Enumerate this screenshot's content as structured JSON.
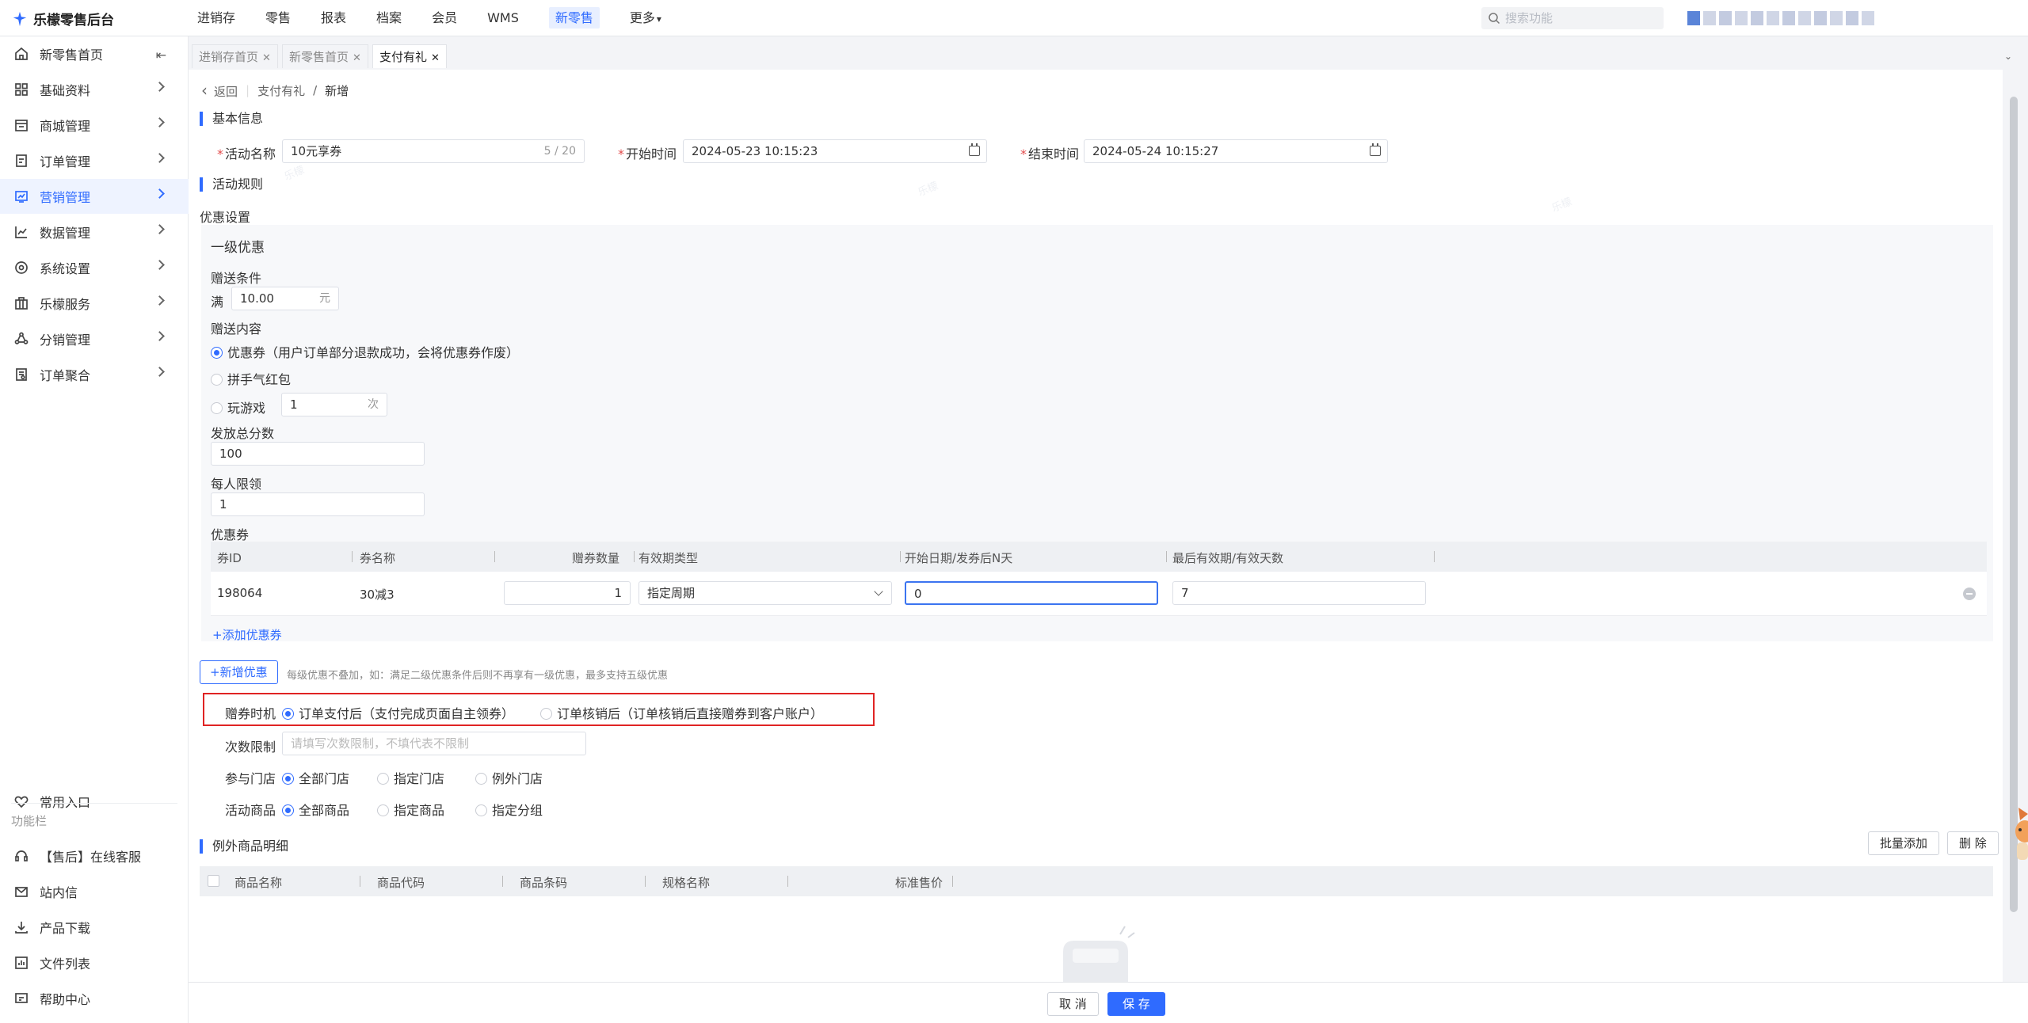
{
  "app": {
    "title": "乐檬零售后台"
  },
  "topnav": [
    {
      "label": "进销存",
      "active": false
    },
    {
      "label": "零售",
      "active": false
    },
    {
      "label": "报表",
      "active": false
    },
    {
      "label": "档案",
      "active": false
    },
    {
      "label": "会员",
      "active": false
    },
    {
      "label": "WMS",
      "active": false
    },
    {
      "label": "新零售",
      "active": true
    },
    {
      "label": "更多",
      "active": false
    }
  ],
  "search": {
    "placeholder": "搜索功能"
  },
  "sidebar": {
    "items": [
      {
        "label": "新零售首页",
        "icon": "home-icon"
      },
      {
        "label": "基础资料",
        "icon": "grid-icon"
      },
      {
        "label": "商城管理",
        "icon": "store-icon"
      },
      {
        "label": "订单管理",
        "icon": "order-icon"
      },
      {
        "label": "营销管理",
        "icon": "marketing-icon",
        "active": true
      },
      {
        "label": "数据管理",
        "icon": "chart-icon"
      },
      {
        "label": "系统设置",
        "icon": "settings-icon"
      },
      {
        "label": "乐檬服务",
        "icon": "service-icon"
      },
      {
        "label": "分销管理",
        "icon": "distribution-icon"
      },
      {
        "label": "订单聚合",
        "icon": "aggregate-icon"
      }
    ],
    "common_entry": "常用入口",
    "function_bar": "功能栏",
    "bottom_items": [
      {
        "label": "【售后】在线客服",
        "icon": "headset-icon"
      },
      {
        "label": "站内信",
        "icon": "mail-icon"
      },
      {
        "label": "产品下载",
        "icon": "download-icon"
      },
      {
        "label": "文件列表",
        "icon": "file-list-icon"
      },
      {
        "label": "帮助中心",
        "icon": "help-icon"
      }
    ]
  },
  "tabs": [
    {
      "label": "进销存首页",
      "active": false
    },
    {
      "label": "新零售首页",
      "active": false
    },
    {
      "label": "支付有礼",
      "active": true
    }
  ],
  "breadcrumb": {
    "back": "返回",
    "parent": "支付有礼",
    "separator": "/",
    "current": "新增"
  },
  "basic_info": {
    "title": "基本信息",
    "name_label": "活动名称",
    "name_value": "10元享券",
    "name_counter": "5 / 20",
    "start_label": "开始时间",
    "start_value": "2024-05-23 10:15:23",
    "end_label": "结束时间",
    "end_value": "2024-05-24 10:15:27"
  },
  "rules": {
    "title": "活动规则",
    "discount_settings": "优惠设置",
    "level_title": "一级优惠",
    "condition_label": "赠送条件",
    "condition_prefix": "满",
    "condition_value": "10.00",
    "condition_unit": "元",
    "content_label": "赠送内容",
    "content_options": [
      {
        "label": "优惠券（用户订单部分退款成功，会将优惠券作废）",
        "checked": true
      },
      {
        "label": "拼手气红包",
        "checked": false
      },
      {
        "label": "玩游戏",
        "checked": false
      }
    ],
    "game_value": "1",
    "game_unit": "次",
    "total_label": "发放总分数",
    "total_value": "100",
    "per_user_label": "每人限领",
    "per_user_value": "1",
    "coupon_label": "优惠券",
    "coupon_columns": [
      "券ID",
      "券名称",
      "赠券数量",
      "有效期类型",
      "开始日期/发券后N天",
      "最后有效期/有效天数"
    ],
    "coupon_rows": [
      {
        "id": "198064",
        "name": "30减3",
        "qty": "1",
        "validity_type": "指定周期",
        "start": "0",
        "end": "7"
      }
    ],
    "add_coupon": "+添加优惠券",
    "add_discount": "+新增优惠",
    "add_discount_hint": "每级优惠不叠加，如：满足二级优惠条件后则不再享有一级优惠，最多支持五级优惠"
  },
  "timing": {
    "label": "赠券时机",
    "options": [
      {
        "label": "订单支付后（支付完成页面自主领券）",
        "checked": true
      },
      {
        "label": "订单核销后（订单核销后直接赠券到客户账户）",
        "checked": false
      }
    ]
  },
  "limit": {
    "label": "次数限制",
    "placeholder": "请填写次数限制，不填代表不限制"
  },
  "stores": {
    "label": "参与门店",
    "options": [
      {
        "label": "全部门店",
        "checked": true
      },
      {
        "label": "指定门店",
        "checked": false
      },
      {
        "label": "例外门店",
        "checked": false
      }
    ]
  },
  "products": {
    "label": "活动商品",
    "options": [
      {
        "label": "全部商品",
        "checked": true
      },
      {
        "label": "指定商品",
        "checked": false
      },
      {
        "label": "指定分组",
        "checked": false
      }
    ]
  },
  "exceptions": {
    "title": "例外商品明细",
    "batch_add": "批量添加",
    "delete": "删 除",
    "columns": [
      "商品名称",
      "商品代码",
      "商品条码",
      "规格名称",
      "标准售价"
    ]
  },
  "footer": {
    "cancel": "取 消",
    "save": "保 存"
  },
  "colors": {
    "primary": "#2f6bff",
    "highlight_border": "#e02323",
    "required": "#e34d4d"
  }
}
